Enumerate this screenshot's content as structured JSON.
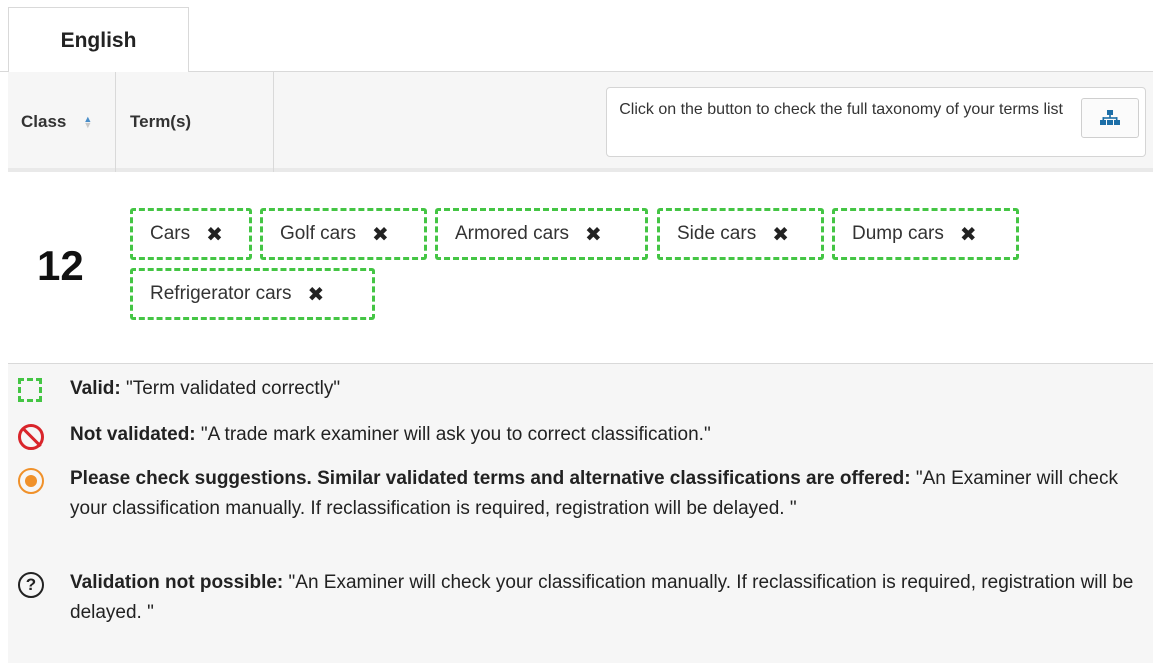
{
  "tabs": [
    {
      "label": "English",
      "active": true
    }
  ],
  "table": {
    "columns": {
      "class": "Class",
      "terms": "Term(s)"
    },
    "taxonomy_hint": "Click on the button to check the full taxonomy of your terms list",
    "rows": [
      {
        "class": "12",
        "terms": [
          "Cars",
          "Golf cars",
          "Armored cars",
          "Side cars",
          "Dump cars",
          "Refrigerator cars"
        ]
      }
    ]
  },
  "remove_glyph": "✖",
  "legend": [
    {
      "icon": "valid-dashed-box-icon",
      "title": "Valid:",
      "text": "\"Term validated correctly\""
    },
    {
      "icon": "not-allowed-icon",
      "title": "Not validated:",
      "text": "\"A trade mark examiner will ask you to correct classification.\""
    },
    {
      "icon": "lightbulb-icon",
      "title": "Please check suggestions. Similar validated terms and alternative classifications are offered:",
      "text": "\"An Examiner will check your classification manually. If reclassification is required, registration will be delayed. \""
    },
    {
      "icon": "question-icon",
      "title": "Validation not possible:",
      "text": "\"An Examiner will check your classification manually. If reclassification is required, registration will be delayed. \""
    }
  ],
  "colors": {
    "valid": "#44c544",
    "invalid": "#d9252b",
    "suggestion": "#f0912a",
    "accent": "#1d6fa8"
  }
}
